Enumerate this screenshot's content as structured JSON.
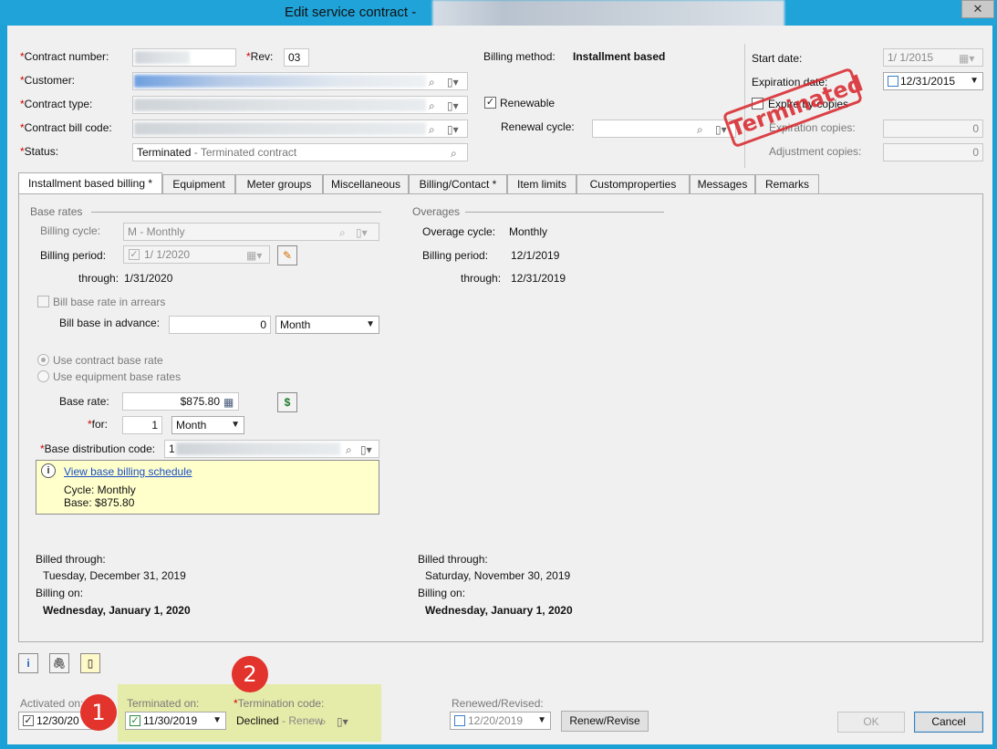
{
  "window": {
    "title": "Edit service contract -",
    "close_glyph": "✕"
  },
  "header": {
    "contract_number_label": "Contract number:",
    "rev_label": "Rev:",
    "rev_value": "03",
    "customer_label": "Customer:",
    "contract_type_label": "Contract type:",
    "contract_bill_code_label": "Contract bill code:",
    "status_label": "Status:",
    "status_value": "Terminated",
    "status_desc": " - Terminated contract",
    "billing_method_label": "Billing method:",
    "billing_method_value": "Installment based",
    "renewable_label": "Renewable",
    "renewal_cycle_label": "Renewal cycle:",
    "start_date_label": "Start date:",
    "start_date_value": "1/  1/2015",
    "expiration_date_label": "Expiration date:",
    "expiration_date_value": "12/31/2015",
    "expire_by_copies_label": "Expire by copies",
    "expiration_copies_label": "Expiration copies:",
    "expiration_copies_value": "0",
    "adjustment_copies_label": "Adjustment copies:",
    "adjustment_copies_value": "0",
    "stamp_text": "Terminated"
  },
  "tabs": [
    {
      "label": "Installment based billing *"
    },
    {
      "label": "Equipment"
    },
    {
      "label": "Meter groups"
    },
    {
      "label": "Miscellaneous"
    },
    {
      "label": "Billing/Contact *"
    },
    {
      "label": "Item limits"
    },
    {
      "label": "Customproperties"
    },
    {
      "label": "Messages"
    },
    {
      "label": "Remarks"
    }
  ],
  "base_rates": {
    "group_label": "Base rates",
    "billing_cycle_label": "Billing cycle:",
    "billing_cycle_value": "M - Monthly",
    "billing_period_label": "Billing period:",
    "billing_period_value": "1/  1/2020",
    "through_label": "through:",
    "through_value": "1/31/2020",
    "bill_in_arrears_label": "Bill base rate in arrears",
    "bill_in_advance_label": "Bill base in advance:",
    "bill_in_advance_value": "0",
    "bill_in_advance_unit": "Month",
    "use_contract_rate_label": "Use contract base rate",
    "use_equipment_rates_label": "Use equipment base rates",
    "base_rate_label": "Base rate:",
    "base_rate_value": "$875.80",
    "for_label": "for:",
    "for_value": "1",
    "for_unit": "Month",
    "distribution_code_label": "Base distribution code:",
    "distribution_code_prefix": "1",
    "schedule_link": "View base billing schedule",
    "cycle_info": "Cycle: Monthly",
    "base_info": "Base: $875.80"
  },
  "overages": {
    "group_label": "Overages",
    "cycle_label": "Overage cycle:",
    "cycle_value": "Monthly",
    "billing_period_label": "Billing period:",
    "billing_period_value": "12/1/2019",
    "through_label": "through:",
    "through_value": "12/31/2019"
  },
  "billing_summary": {
    "left_billed_through_label": "Billed through:",
    "left_billed_through_value": "Tuesday, December 31, 2019",
    "left_billing_on_label": "Billing on:",
    "left_billing_on_value": "Wednesday, January 1, 2020",
    "right_billed_through_label": "Billed through:",
    "right_billed_through_value": "Saturday, November 30, 2019",
    "right_billing_on_label": "Billing on:",
    "right_billing_on_value": "Wednesday, January 1, 2020"
  },
  "footer": {
    "activated_label": "Activated on:",
    "activated_value": "12/30/20",
    "terminated_label": "Terminated on:",
    "terminated_value": "11/30/2019",
    "termination_code_label": "Termination code:",
    "termination_code_value": "Declined",
    "termination_code_desc": " - Renew",
    "renewed_label": "Renewed/Revised:",
    "renewed_value": "12/20/2019",
    "renew_button": "Renew/Revise",
    "ok_button": "OK",
    "cancel_button": "Cancel",
    "callout_1": "1",
    "callout_2": "2"
  },
  "colors": {
    "titlebar": "#1fa3d8",
    "required_asterisk": "#d40000",
    "stamp": "#d8242a",
    "info_box": "#ffffcc",
    "highlight": "#dce86e",
    "callout": "#e2332c"
  }
}
